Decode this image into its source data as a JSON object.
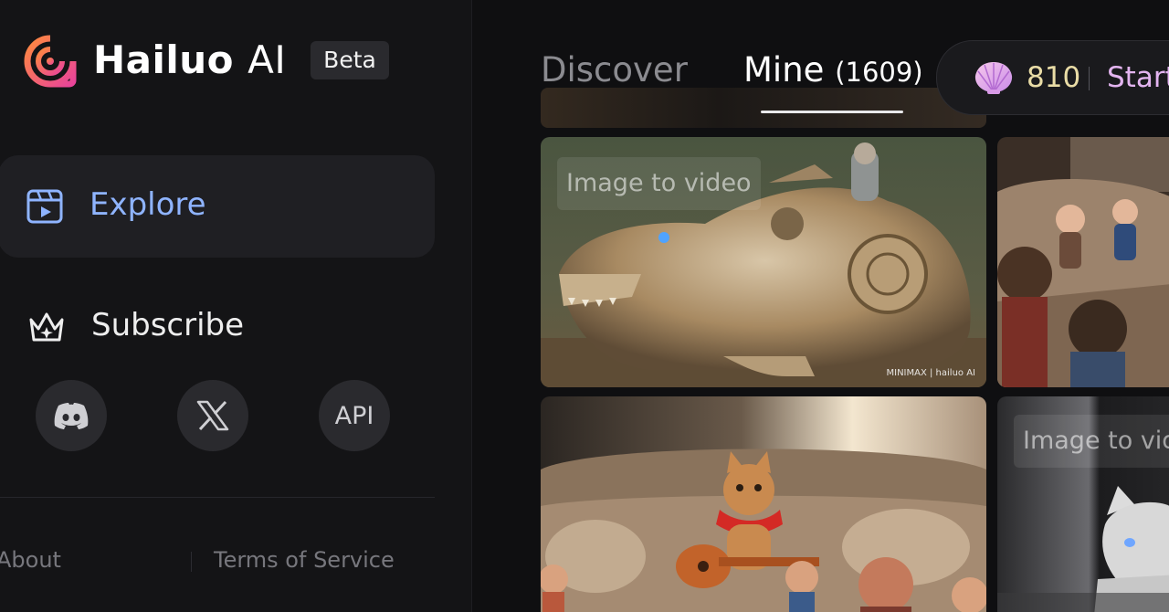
{
  "brand": {
    "name": "Hailuo",
    "name_suffix": "AI",
    "badge": "Beta"
  },
  "sidebar": {
    "items": [
      {
        "label": "Explore",
        "icon": "explore-icon",
        "active": true
      },
      {
        "label": "Subscribe",
        "icon": "crown-icon",
        "active": false
      }
    ],
    "social": [
      {
        "icon": "discord-icon"
      },
      {
        "icon": "x-icon"
      },
      {
        "label": "API"
      }
    ],
    "footer": {
      "about": "About",
      "terms": "Terms of Service"
    }
  },
  "header": {
    "tabs": [
      {
        "label": "Discover",
        "active": false
      },
      {
        "label": "Mine",
        "count": "(1609)",
        "active": true
      }
    ],
    "credits": {
      "icon": "shell-icon",
      "value": "810",
      "action": "Start"
    }
  },
  "gallery": {
    "cards": [
      {
        "tag": "Image to video",
        "watermark": "MINIMAX | hailuo AI"
      },
      {
        "tag": ""
      },
      {
        "tag": ""
      },
      {
        "tag": "Image to video"
      }
    ]
  },
  "colors": {
    "background": "#141416",
    "accent": "#8fb4ff",
    "credits": "#e9dca6",
    "start": "#e3b4f0"
  }
}
